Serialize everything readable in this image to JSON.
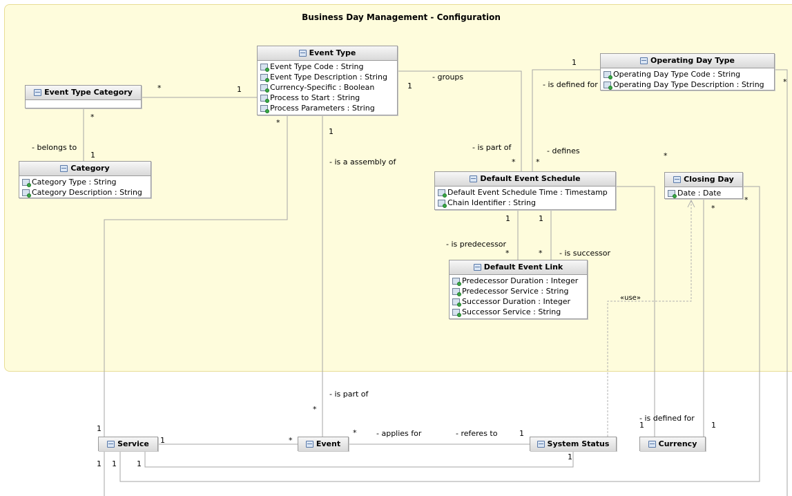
{
  "package": {
    "title": "Business Day Management - Configuration"
  },
  "classes": {
    "event_type": {
      "name": "Event Type",
      "attributes": [
        "Event Type Code : String",
        "Event Type Description : String",
        "Currency-Specific : Boolean",
        "Process to Start : String",
        "Process Parameters : String"
      ]
    },
    "event_type_category": {
      "name": "Event Type Category",
      "attributes": []
    },
    "category": {
      "name": "Category",
      "attributes": [
        "Category Type : String",
        "Category Description : String"
      ]
    },
    "operating_day_type": {
      "name": "Operating Day Type",
      "attributes": [
        "Operating Day Type Code : String",
        "Operating Day Type Description : String"
      ]
    },
    "default_event_schedule": {
      "name": "Default Event Schedule",
      "attributes": [
        "Default Event Schedule Time : Timestamp",
        "Chain Identifier : String"
      ]
    },
    "closing_day": {
      "name": "Closing Day",
      "attributes": [
        "Date : Date"
      ]
    },
    "default_event_link": {
      "name": "Default Event Link",
      "attributes": [
        "Predecessor Duration : Integer",
        "Predecessor Service : String",
        "Successor Duration : Integer",
        "Successor Service : String"
      ]
    },
    "service": {
      "name": "Service"
    },
    "event": {
      "name": "Event"
    },
    "system_status": {
      "name": "System Status"
    },
    "currency": {
      "name": "Currency"
    }
  },
  "labels": {
    "belongs_to": "- belongs to",
    "groups": "- groups",
    "is_defined_for_1": "- is defined for",
    "is_part_of_1": "- is part of",
    "defines": "- defines",
    "is_a_assembly_of": "- is a assembly of",
    "is_predecessor": "- is predecessor",
    "is_successor": "- is successor",
    "use": "«use»",
    "is_part_of_2": "- is part of",
    "applies_for": "- applies for",
    "referes_to": "- referes to",
    "is_defined_for_2": "- is defined for"
  },
  "multiplicities": {
    "etc_et_star": "*",
    "etc_et_one": "1",
    "etc_cat_star": "*",
    "etc_cat_one": "1",
    "groups_one": "1",
    "odt_one": "1",
    "odt_right_star": "*",
    "et_bottom_star": "*",
    "et_bottom_one": "1",
    "des_top_star_left": "*",
    "des_top_star_right": "*",
    "closing_star_top": "*",
    "des_pred_one": "1",
    "des_succ_one": "1",
    "del_pred_star": "*",
    "del_succ_star": "*",
    "closing_right_star": "*",
    "closing_bottom_star": "*",
    "event_part_star": "*",
    "service_top_one": "1",
    "service_event_one": "1",
    "event_service_star": "*",
    "event_applies_star": "*",
    "status_one": "1",
    "status_bottom_one": "1",
    "currency_one_left": "1",
    "currency_one_right": "1",
    "service_bottom_one_a": "1",
    "service_bottom_one_b": "1",
    "service_bottom_one_c": "1"
  }
}
